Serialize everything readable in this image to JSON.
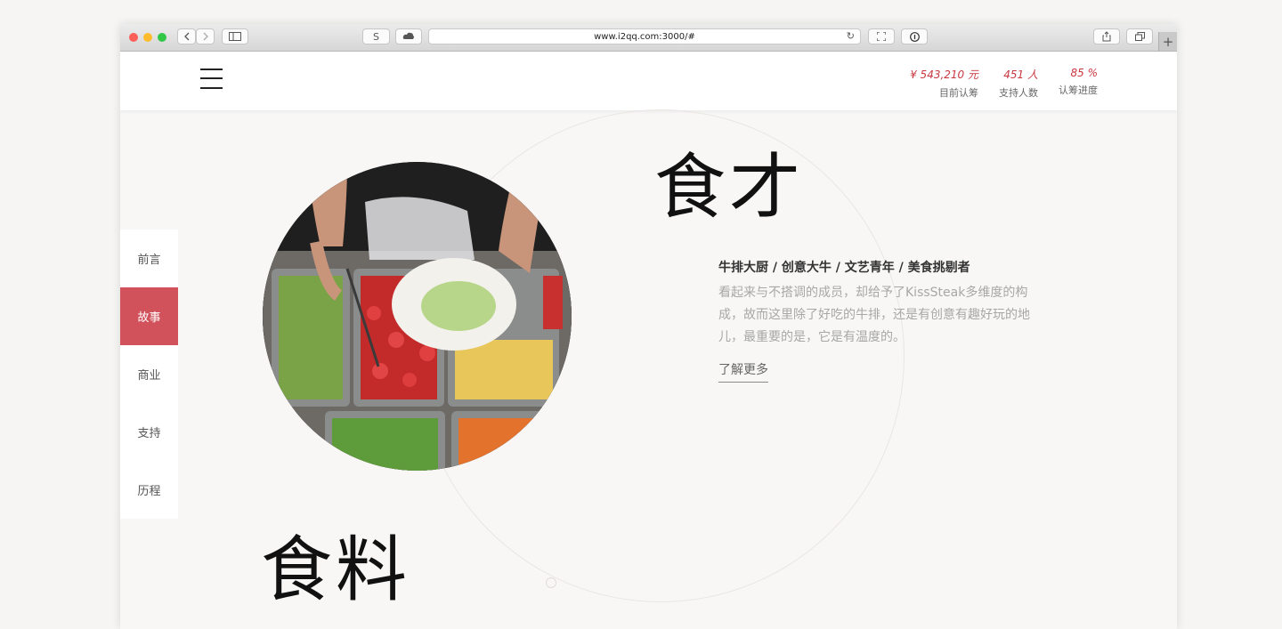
{
  "browser": {
    "url": "www.i2qq.com:3000/#",
    "s_button": "S",
    "new_tab": "+"
  },
  "stats": [
    {
      "value": "¥ 543,210 元",
      "label": "目前认筹"
    },
    {
      "value": "451 人",
      "label": "支持人数"
    },
    {
      "value": "85 %",
      "label": "认筹进度"
    }
  ],
  "nav": {
    "items": [
      "前言",
      "故事",
      "商业",
      "支持",
      "历程"
    ],
    "active": "故事"
  },
  "section1": {
    "title": "食才",
    "subtitle": "牛排大厨 / 创意大牛 / 文艺青年 / 美食挑剔者",
    "desc": "看起来与不搭调的成员，却给予了KissSteak多维度的构成，故而这里除了好吃的牛排，还是有创意有趣好玩的地儿，最重要的是，它是有温度的。",
    "more": "了解更多"
  },
  "section2": {
    "title": "食料"
  },
  "colors": {
    "accent": "#d1525b",
    "stat_value": "#c9373f"
  }
}
